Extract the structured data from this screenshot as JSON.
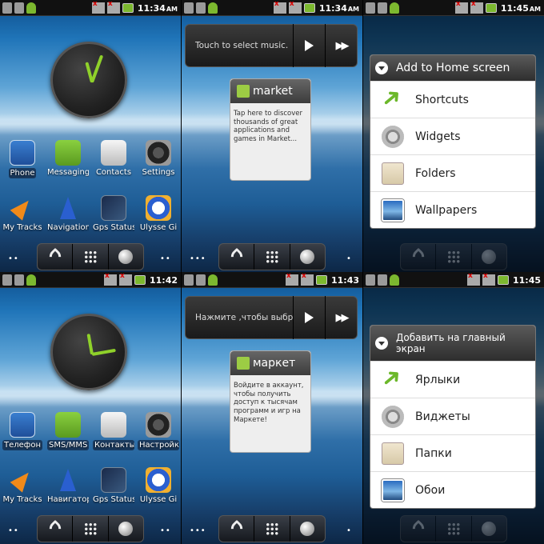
{
  "panels": [
    {
      "time": "11:34",
      "ampm": "AM",
      "apps": [
        "Phone",
        "Messaging",
        "Contacts",
        "Settings",
        "My Tracks",
        "Navigation",
        "Gps Status",
        "Ulysse Gi"
      ]
    },
    {
      "time": "11:34",
      "ampm": "AM",
      "music_text": "Touch to select music.",
      "market_name": "market",
      "market_body": "Tap here to discover thousands of great applications and games in Market..."
    },
    {
      "time": "11:45",
      "ampm": "AM",
      "dialog_title": "Add to Home screen",
      "options": [
        "Shortcuts",
        "Widgets",
        "Folders",
        "Wallpapers"
      ]
    },
    {
      "time": "11:42",
      "ampm": "",
      "apps": [
        "Телефон",
        "SMS/MMS",
        "Контакты",
        "Настройки",
        "My Tracks",
        "Навигатор",
        "Gps Status",
        "Ulysse Gi"
      ]
    },
    {
      "time": "11:43",
      "ampm": "",
      "music_text": "Нажмите ,чтобы выбра",
      "market_name": "маркет",
      "market_body": "Войдите в аккаунт, чтобы получить доступ к тысячам программ и игр на Маркете!"
    },
    {
      "time": "11:45",
      "ampm": "",
      "dialog_title": "Добавить на главный экран",
      "options": [
        "Ярлыки",
        "Виджеты",
        "Папки",
        "Обои"
      ]
    }
  ]
}
